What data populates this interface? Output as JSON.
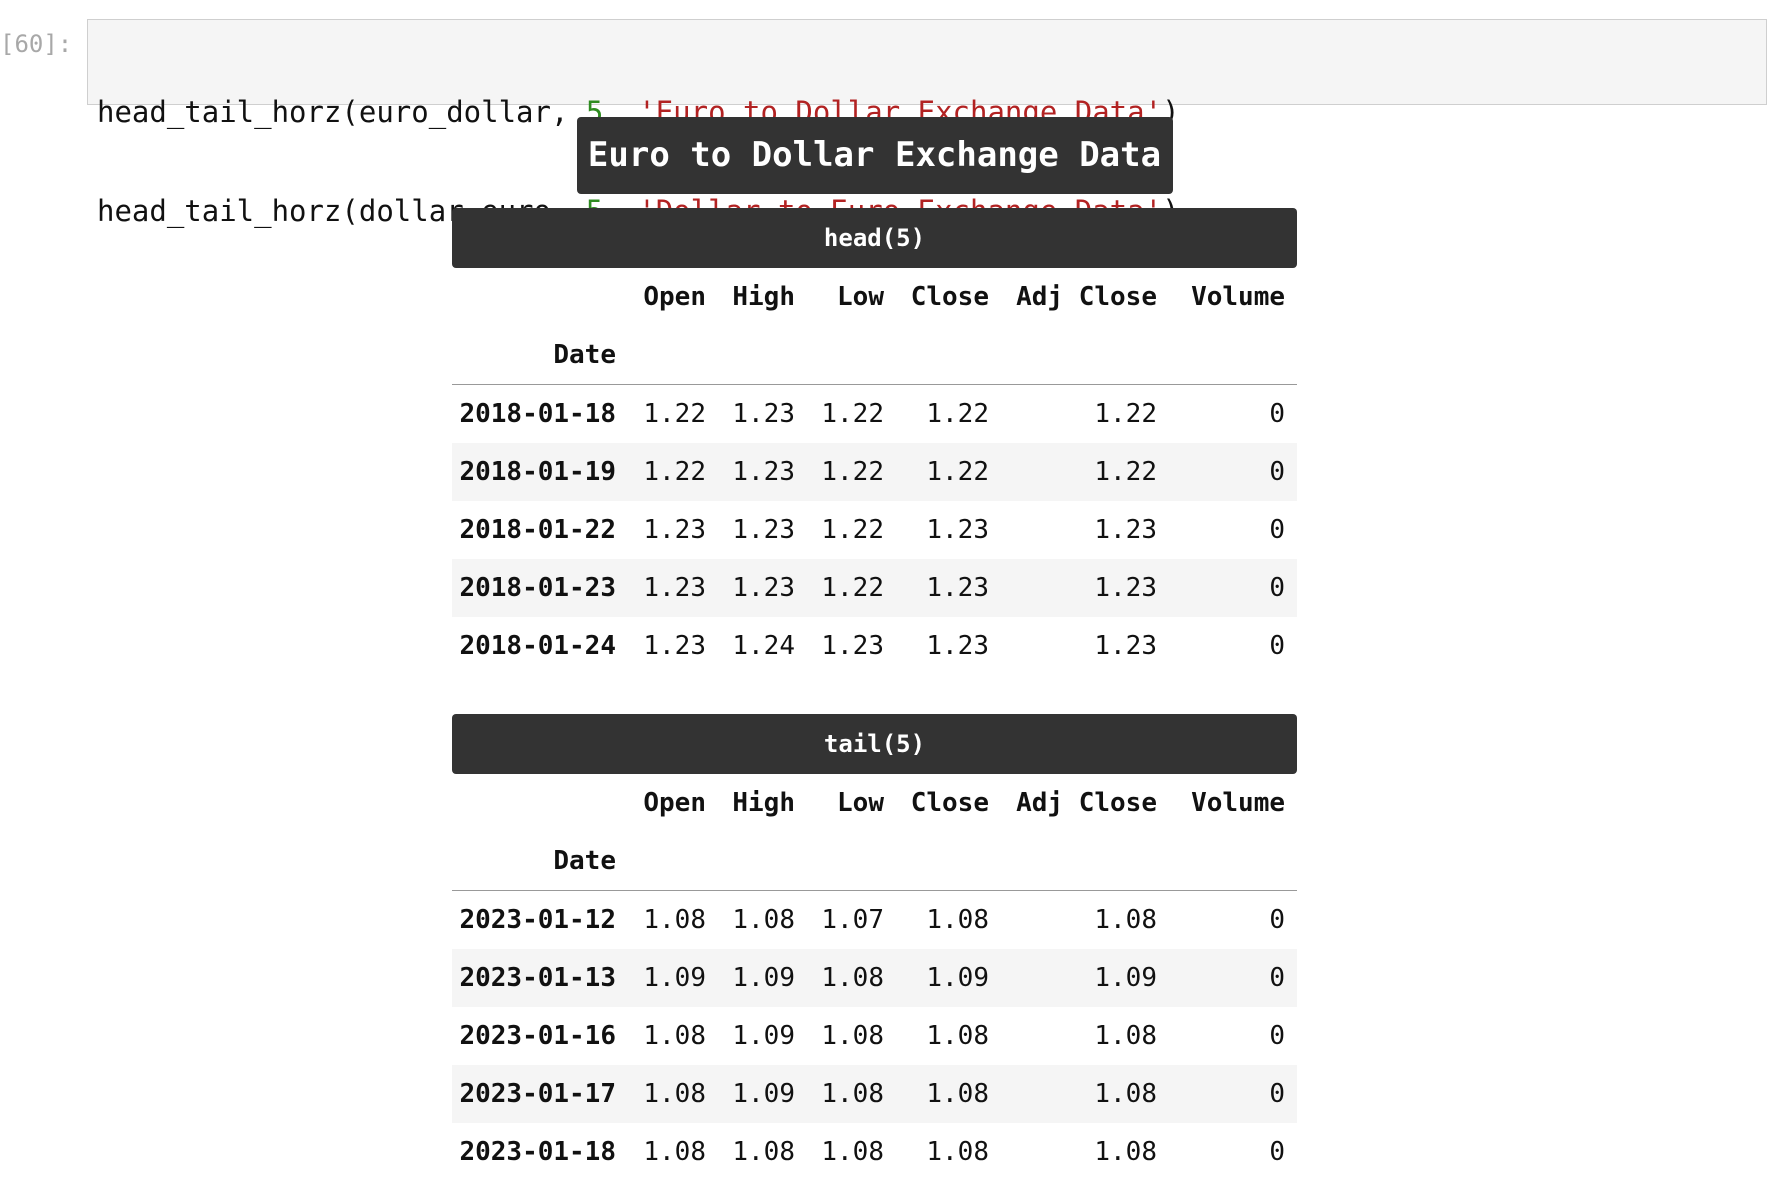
{
  "cell": {
    "prompt": "[60]:",
    "lines": [
      {
        "fn": "head_tail_horz(euro_dollar, ",
        "num": "5",
        "sep": ", ",
        "str": "'Euro to Dollar Exchange Data'",
        "end": ")"
      },
      {
        "fn": "head_tail_horz(dollar_euro, ",
        "num": "5",
        "sep": ", ",
        "str": "'Dollar to Euro Exchange Data'",
        "end": ")"
      }
    ]
  },
  "output": {
    "title": "Euro to Dollar Exchange Data",
    "columns": [
      "Open",
      "High",
      "Low",
      "Close",
      "Adj Close",
      "Volume"
    ],
    "index_name": "Date",
    "head": {
      "label": "head(5)",
      "rows": [
        {
          "date": "2018-01-18",
          "open": "1.22",
          "high": "1.23",
          "low": "1.22",
          "close": "1.22",
          "adj_close": "1.22",
          "volume": "0"
        },
        {
          "date": "2018-01-19",
          "open": "1.22",
          "high": "1.23",
          "low": "1.22",
          "close": "1.22",
          "adj_close": "1.22",
          "volume": "0"
        },
        {
          "date": "2018-01-22",
          "open": "1.23",
          "high": "1.23",
          "low": "1.22",
          "close": "1.23",
          "adj_close": "1.23",
          "volume": "0"
        },
        {
          "date": "2018-01-23",
          "open": "1.23",
          "high": "1.23",
          "low": "1.22",
          "close": "1.23",
          "adj_close": "1.23",
          "volume": "0"
        },
        {
          "date": "2018-01-24",
          "open": "1.23",
          "high": "1.24",
          "low": "1.23",
          "close": "1.23",
          "adj_close": "1.23",
          "volume": "0"
        }
      ]
    },
    "tail": {
      "label": "tail(5)",
      "rows": [
        {
          "date": "2023-01-12",
          "open": "1.08",
          "high": "1.08",
          "low": "1.07",
          "close": "1.08",
          "adj_close": "1.08",
          "volume": "0"
        },
        {
          "date": "2023-01-13",
          "open": "1.09",
          "high": "1.09",
          "low": "1.08",
          "close": "1.09",
          "adj_close": "1.09",
          "volume": "0"
        },
        {
          "date": "2023-01-16",
          "open": "1.08",
          "high": "1.09",
          "low": "1.08",
          "close": "1.08",
          "adj_close": "1.08",
          "volume": "0"
        },
        {
          "date": "2023-01-17",
          "open": "1.08",
          "high": "1.09",
          "low": "1.08",
          "close": "1.08",
          "adj_close": "1.08",
          "volume": "0"
        },
        {
          "date": "2023-01-18",
          "open": "1.08",
          "high": "1.08",
          "low": "1.08",
          "close": "1.08",
          "adj_close": "1.08",
          "volume": "0"
        }
      ]
    }
  },
  "colors": {
    "header_bg": "#333333",
    "stripe": "#f5f5f5",
    "number_token": "#2e8b20",
    "string_token": "#b22222"
  }
}
